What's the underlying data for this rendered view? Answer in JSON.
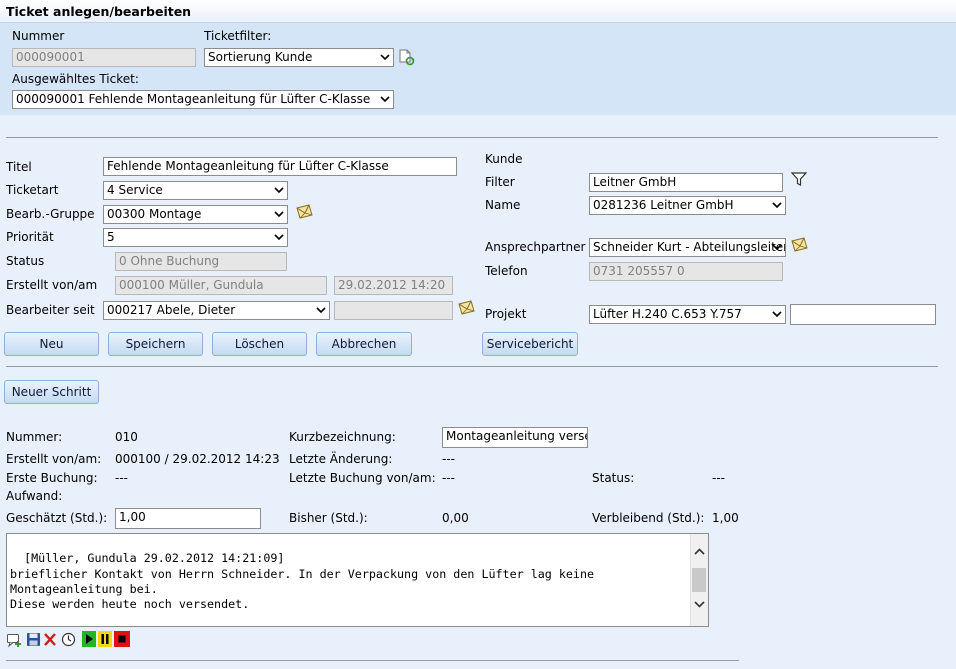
{
  "title": "Ticket anlegen/bearbeiten",
  "header": {
    "nummer_label": "Nummer",
    "nummer_value": "000090001",
    "filter_label": "Ticketfilter:",
    "filter_value": "Sortierung Kunde",
    "selected_label": "Ausgewähltes Ticket:",
    "selected_value": "000090001 Fehlende Montageanleitung für Lüfter C-Klasse"
  },
  "form": {
    "titel_label": "Titel",
    "titel_value": "Fehlende Montageanleitung für Lüfter C-Klasse",
    "ticketart_label": "Ticketart",
    "ticketart_value": "4 Service",
    "gruppe_label": "Bearb.-Gruppe",
    "gruppe_value": "00300 Montage",
    "prioritaet_label": "Priorität",
    "prioritaet_value": "5",
    "status_label": "Status",
    "status_value": "0 Ohne Buchung",
    "erstellt_label": "Erstellt von/am",
    "erstellt_von": "000100 Müller, Gundula",
    "erstellt_am": "29.02.2012 14:20",
    "bearbeiter_label": "Bearbeiter seit",
    "bearbeiter_value": "000217 Abele, Dieter",
    "bearbeiter_seit": "",
    "kunde_label": "Kunde",
    "filter_label": "Filter",
    "filter_value": "Leitner GmbH",
    "name_label": "Name",
    "name_value": "0281236 Leitner GmbH",
    "ansprech_label": "Ansprechpartner",
    "ansprech_value": "Schneider Kurt - Abteilungsleiter",
    "telefon_label": "Telefon",
    "telefon_value": "0731 205557 0",
    "projekt_label": "Projekt",
    "projekt_value": "Lüfter H.240 C.653 Y.757",
    "projekt_extra": ""
  },
  "buttons": {
    "neu": "Neu",
    "speichern": "Speichern",
    "loeschen": "Löschen",
    "abbrechen": "Abbrechen",
    "servicebericht": "Servicebericht",
    "neuer_schritt": "Neuer Schritt"
  },
  "step": {
    "nummer_label": "Nummer:",
    "nummer_value": "010",
    "kurz_label": "Kurzbezeichnung:",
    "kurz_value": "Montageanleitung versenden",
    "erstellt_label": "Erstellt von/am:",
    "erstellt_value": "000100 / 29.02.2012 14:23",
    "letzte_aend_label": "Letzte Änderung:",
    "letzte_aend_value": "---",
    "erste_buchung_label": "Erste Buchung:",
    "erste_buchung_value": "---",
    "letzte_buchung_label": "Letzte Buchung von/am:",
    "letzte_buchung_value": "---",
    "status_label": "Status:",
    "status_value": "---",
    "aufwand_label": "Aufwand:",
    "geschaetzt_label": "Geschätzt (Std.):",
    "geschaetzt_value": "1,00",
    "bisher_label": "Bisher (Std.):",
    "bisher_value": "0,00",
    "verbleibend_label": "Verbleibend (Std.):",
    "verbleibend_value": "1,00",
    "notes": "[Müller, Gundula 29.02.2012 14:21:09]\nbrieflicher Kontakt von Herrn Schneider. In der Verpackung von den Lüfter lag keine\nMontageanleitung bei.\nDiese werden heute noch versendet."
  },
  "icons": {
    "refresh": "refresh-document-icon",
    "filter": "funnel-filter-icon",
    "mail": "envelope-icon",
    "add_note": "add-note-icon",
    "save": "floppy-disk-icon",
    "delete": "red-x-icon",
    "clock": "clock-icon",
    "play": "play-icon",
    "pause": "pause-icon",
    "stop": "stop-icon"
  }
}
